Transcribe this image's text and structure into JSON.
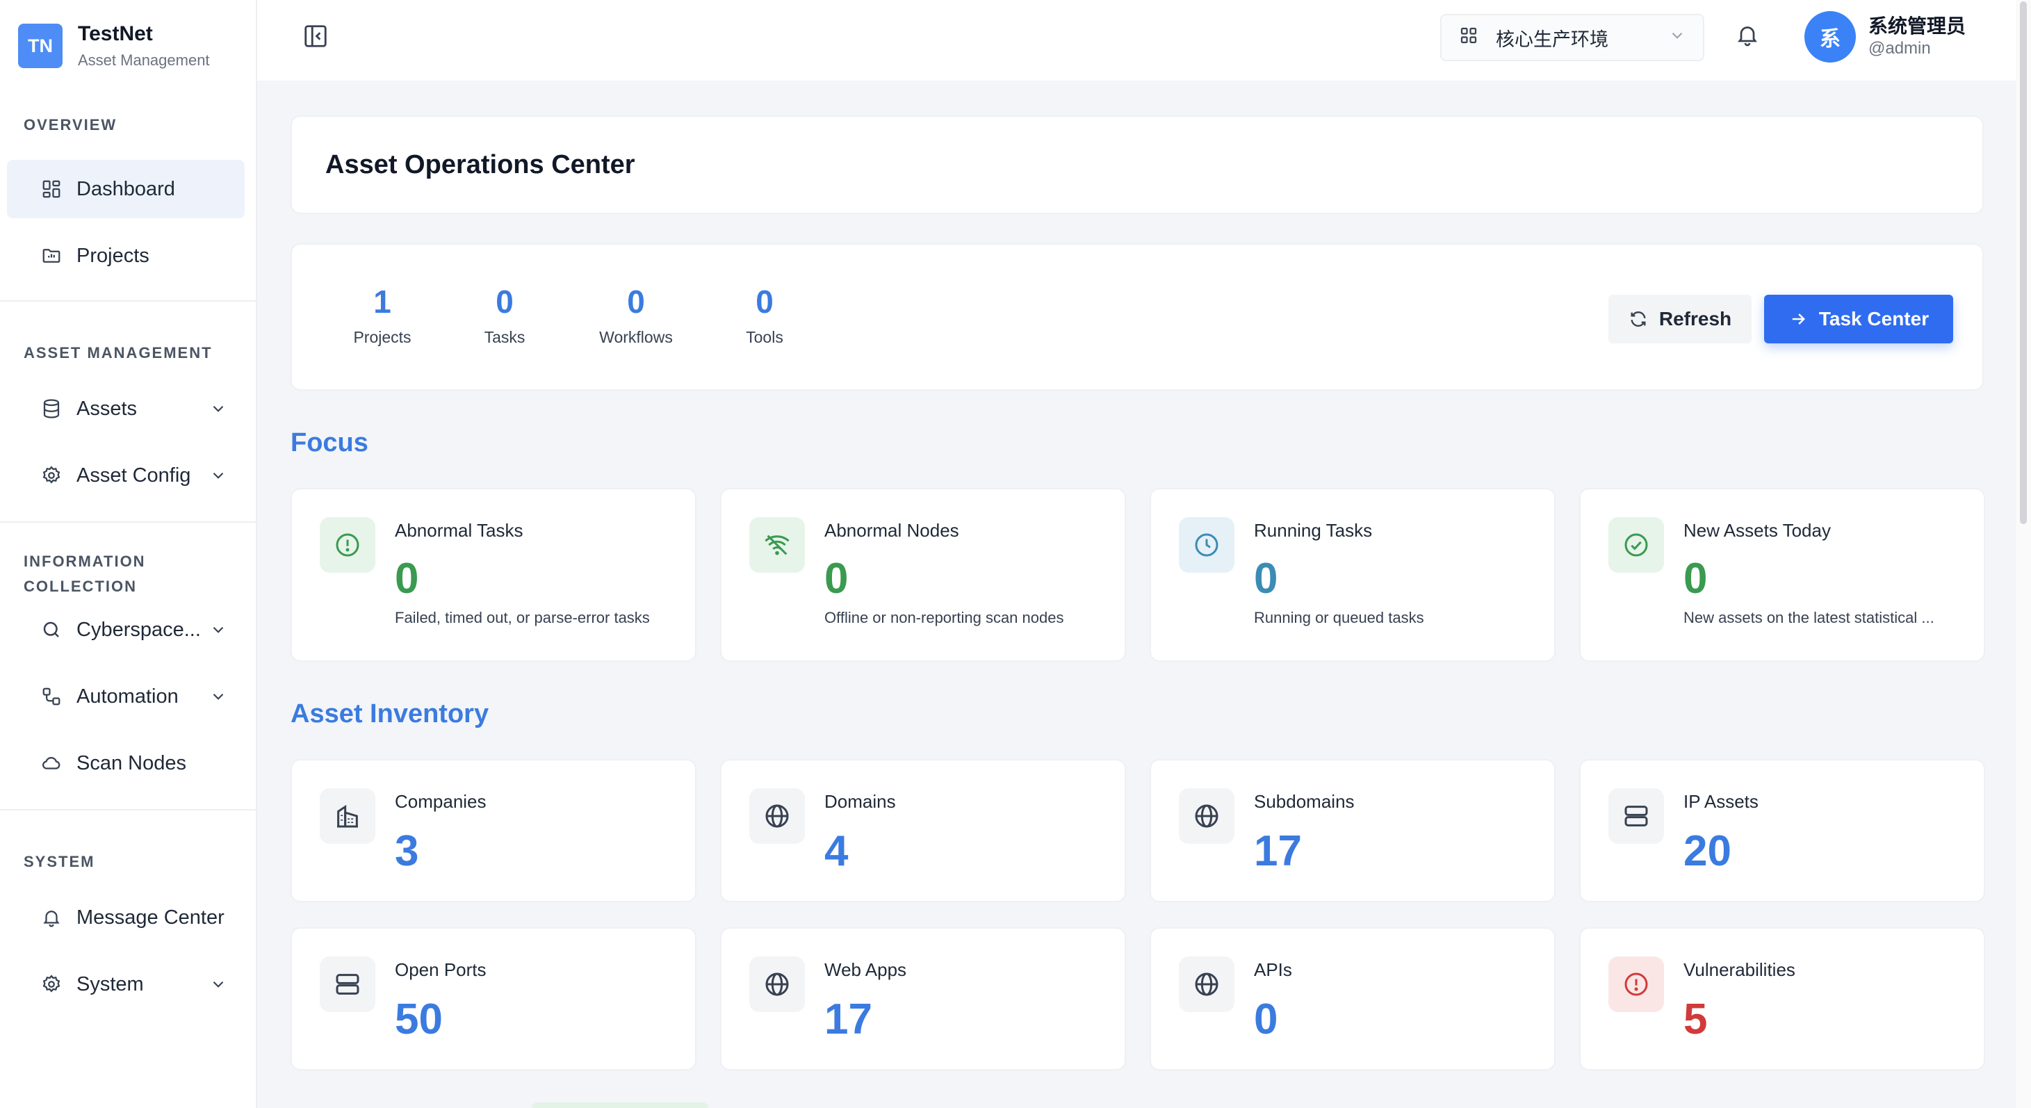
{
  "brand": {
    "logo_text": "TN",
    "title": "TestNet",
    "subtitle": "Asset Management"
  },
  "sidebar": {
    "sections": [
      {
        "label": "OVERVIEW"
      },
      {
        "label": "ASSET MANAGEMENT"
      },
      {
        "label": "INFORMATION COLLECTION"
      },
      {
        "label": "SYSTEM"
      }
    ],
    "items": [
      {
        "label": "Dashboard",
        "icon": "dashboard-icon",
        "active": true
      },
      {
        "label": "Projects",
        "icon": "folder-icon"
      },
      {
        "label": "Assets",
        "icon": "database-icon",
        "expandable": true
      },
      {
        "label": "Asset Config",
        "icon": "gear-icon",
        "expandable": true
      },
      {
        "label": "Cyberspace...",
        "icon": "search-icon",
        "expandable": true
      },
      {
        "label": "Automation",
        "icon": "workflow-icon",
        "expandable": true
      },
      {
        "label": "Scan Nodes",
        "icon": "cloud-icon"
      },
      {
        "label": "Message Center",
        "icon": "bell-icon"
      },
      {
        "label": "System",
        "icon": "gear-icon",
        "expandable": true
      }
    ]
  },
  "header": {
    "environment": "核心生产环境",
    "user": {
      "avatar_text": "系",
      "name": "系统管理员",
      "handle": "@admin"
    }
  },
  "main": {
    "title": "Asset Operations Center",
    "stats": [
      {
        "value": "1",
        "label": "Projects"
      },
      {
        "value": "0",
        "label": "Tasks"
      },
      {
        "value": "0",
        "label": "Workflows"
      },
      {
        "value": "0",
        "label": "Tools"
      }
    ],
    "refresh_label": "Refresh",
    "task_center_label": "Task Center",
    "focus_heading": "Focus",
    "focus": [
      {
        "title": "Abnormal Tasks",
        "value": "0",
        "desc": "Failed, timed out, or parse-error tasks",
        "icon": "alert-circle-icon",
        "color": "#3a9a4f"
      },
      {
        "title": "Abnormal Nodes",
        "value": "0",
        "desc": "Offline or non-reporting scan nodes",
        "icon": "wifi-off-icon",
        "color": "#3a9a4f"
      },
      {
        "title": "Running Tasks",
        "value": "0",
        "desc": "Running or queued tasks",
        "icon": "clock-icon",
        "color": "#3b8cb5"
      },
      {
        "title": "New Assets Today",
        "value": "0",
        "desc": "New assets on the latest statistical ...",
        "icon": "check-circle-icon",
        "color": "#3a9a4f"
      }
    ],
    "inventory_heading": "Asset Inventory",
    "inventory": [
      {
        "title": "Companies",
        "value": "3",
        "icon": "building-icon",
        "color": "#3b7be0"
      },
      {
        "title": "Domains",
        "value": "4",
        "icon": "globe-icon",
        "color": "#3b7be0"
      },
      {
        "title": "Subdomains",
        "value": "17",
        "icon": "globe-icon",
        "color": "#3b7be0"
      },
      {
        "title": "IP Assets",
        "value": "20",
        "icon": "server-icon",
        "color": "#3b7be0"
      },
      {
        "title": "Open Ports",
        "value": "50",
        "icon": "server-icon",
        "color": "#3b7be0"
      },
      {
        "title": "Web Apps",
        "value": "17",
        "icon": "globe-icon",
        "color": "#3b7be0"
      },
      {
        "title": "APIs",
        "value": "0",
        "icon": "globe-icon",
        "color": "#3b7be0"
      },
      {
        "title": "Vulnerabilities",
        "value": "5",
        "icon": "alert-circle-icon",
        "color": "#d13a3a"
      }
    ]
  }
}
